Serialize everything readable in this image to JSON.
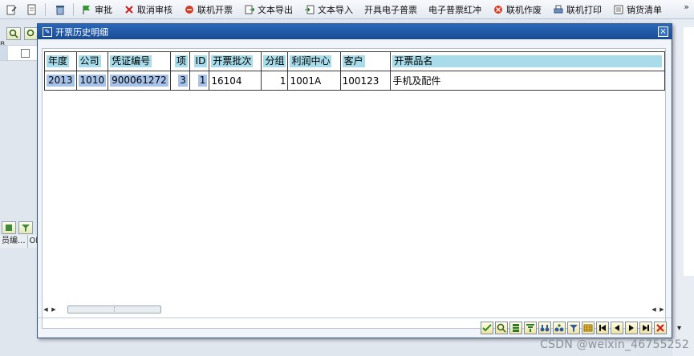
{
  "toolbar": {
    "items": [
      {
        "label": "审批",
        "icon": "green-flag-icon"
      },
      {
        "label": "取消审核",
        "icon": "red-x-icon"
      },
      {
        "label": "联机开票",
        "icon": "red-circle-icon"
      },
      {
        "label": "文本导出",
        "icon": "export-icon"
      },
      {
        "label": "文本导入",
        "icon": "import-icon"
      },
      {
        "label": "开具电子普票",
        "icon": ""
      },
      {
        "label": "电子普票红冲",
        "icon": ""
      },
      {
        "label": "联机作废",
        "icon": "red-circle-icon"
      },
      {
        "label": "联机打印",
        "icon": "printer-icon"
      },
      {
        "label": "销货清单",
        "icon": "list-icon"
      }
    ],
    "more": "»"
  },
  "background": {
    "fragment_top": "B",
    "col_headers": [
      "员编...",
      "Ob"
    ]
  },
  "dialog": {
    "title": "开票历史明细",
    "close": "×"
  },
  "table": {
    "headers": [
      "年度",
      "公司",
      "凭证编号",
      "项",
      "ID",
      "开票批次",
      "分组",
      "利润中心",
      "客户",
      "开票品名"
    ],
    "rows": [
      {
        "year": "2013",
        "company": "1010",
        "doc_no": "900061272",
        "item": "3",
        "id": "1",
        "batch": "16104",
        "group": "1",
        "profit_center": "1001A",
        "customer": "100123",
        "product": "手机及配件"
      }
    ]
  },
  "watermark": "CSDN @weixin_46755252",
  "colors": {
    "title_bar": "#1f56a3",
    "header_highlight": "#a8dcea",
    "selection_highlight": "#a7c3ea",
    "background": "#dfe6ee"
  }
}
